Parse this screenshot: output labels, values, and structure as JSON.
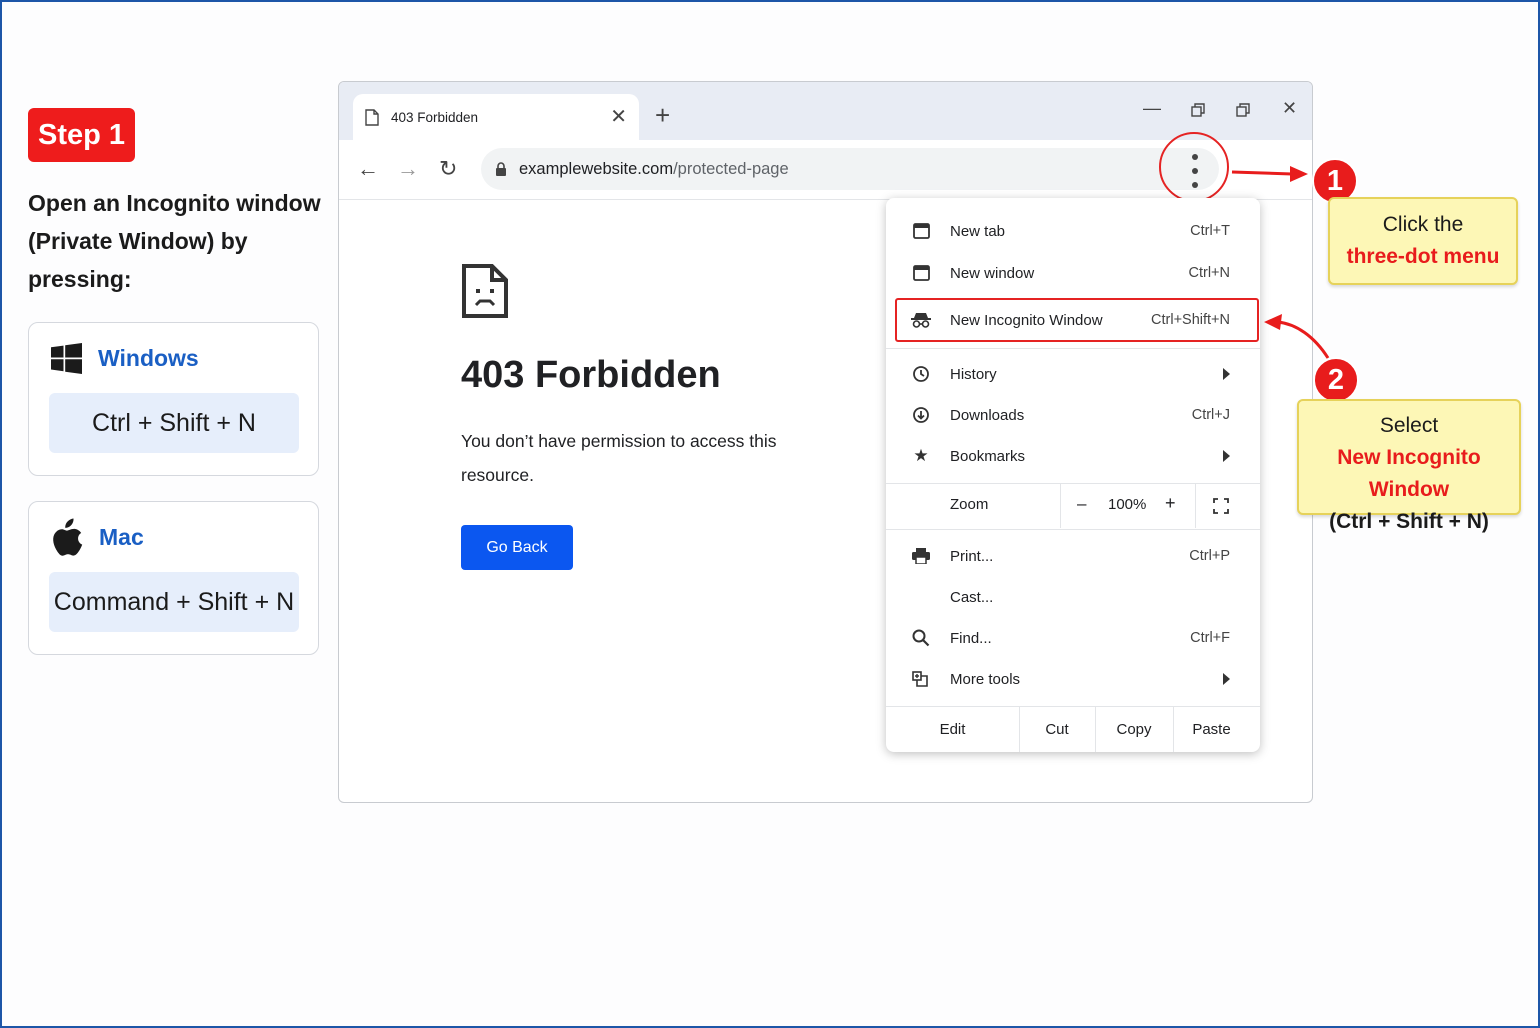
{
  "step": {
    "badge": "Step 1",
    "instruction": "Open an Incognito window (Private Window) by pressing:"
  },
  "os": {
    "windows": {
      "name": "Windows",
      "shortcut": "Ctrl + Shift + N",
      "icon": "windows-logo-icon"
    },
    "mac": {
      "name": "Mac",
      "shortcut": "Command + Shift + N",
      "icon": "apple-logo-icon"
    }
  },
  "browser": {
    "tab_title": "403 Forbidden",
    "url_host": "examplewebsite.com",
    "url_path": "/protected-page"
  },
  "page": {
    "title": "403 Forbidden",
    "message": "You don’t have permission to access this resource.",
    "button": "Go Back"
  },
  "menu": {
    "new_tab": {
      "label": "New tab",
      "shortcut": "Ctrl+T"
    },
    "new_window": {
      "label": "New window",
      "shortcut": "Ctrl+N"
    },
    "incognito": {
      "label": "New Incognito Window",
      "shortcut": "Ctrl+Shift+N"
    },
    "history": {
      "label": "History"
    },
    "downloads": {
      "label": "Downloads",
      "shortcut": "Ctrl+J"
    },
    "bookmarks": {
      "label": "Bookmarks"
    },
    "zoom": {
      "label": "Zoom",
      "minus": "–",
      "value": "100%",
      "plus": "+"
    },
    "print": {
      "label": "Print...",
      "shortcut": "Ctrl+P"
    },
    "cast": {
      "label": "Cast..."
    },
    "find": {
      "label": "Find...",
      "shortcut": "Ctrl+F"
    },
    "more_tools": {
      "label": "More tools"
    },
    "edit": {
      "label": "Edit",
      "cut": "Cut",
      "copy": "Copy",
      "paste": "Paste"
    }
  },
  "callouts": {
    "one": {
      "number": "1",
      "line1": "Click the",
      "line2": "three-dot menu"
    },
    "two": {
      "number": "2",
      "line1": "Select",
      "line2": "New Incognito Window",
      "line3": "(Ctrl + Shift + N)"
    }
  },
  "colors": {
    "accent_red": "#e81c1c",
    "link_blue": "#1a5fc4",
    "button_blue": "#0b57f0",
    "callout_yellow": "#fdf7b6"
  }
}
